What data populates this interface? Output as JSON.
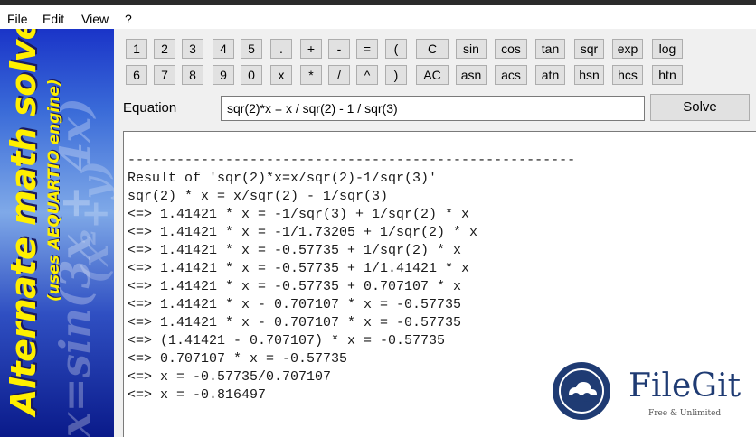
{
  "menu": [
    "File",
    "Edit",
    "View",
    "?"
  ],
  "banner": {
    "title": "Alternate math solver",
    "subtitle": "(uses AEQUARTIO engine)",
    "bg_expr": "x=sin(3x + 4x)",
    "bg_expr2": "(x²+y)"
  },
  "keypad": {
    "row1": [
      "1",
      "2",
      "3",
      "4",
      "5",
      ".",
      "+",
      "-",
      "=",
      "(",
      "C",
      "sin",
      "cos",
      "tan",
      "sqr",
      "exp",
      "log"
    ],
    "row2": [
      "6",
      "7",
      "8",
      "9",
      "0",
      "x",
      "*",
      "/",
      "^",
      ")",
      "AC",
      "asn",
      "acs",
      "atn",
      "hsn",
      "hcs",
      "htn"
    ]
  },
  "equation": {
    "label": "Equation",
    "value": "sqr(2)*x = x / sqr(2) - 1 / sqr(3)",
    "solve_label": "Solve"
  },
  "output_lines": [
    "-------------------------------------------------------",
    "Result of 'sqr(2)*x=x/sqr(2)-1/sqr(3)'",
    "sqr(2) * x = x/sqr(2) - 1/sqr(3)",
    "<=> 1.41421 * x = -1/sqr(3) + 1/sqr(2) * x",
    "<=> 1.41421 * x = -1/1.73205 + 1/sqr(2) * x",
    "<=> 1.41421 * x = -0.57735 + 1/sqr(2) * x",
    "<=> 1.41421 * x = -0.57735 + 1/1.41421 * x",
    "<=> 1.41421 * x = -0.57735 + 0.707107 * x",
    "<=> 1.41421 * x - 0.707107 * x = -0.57735",
    "<=> 1.41421 * x - 0.707107 * x = -0.57735",
    "<=> (1.41421 - 0.707107) * x = -0.57735",
    "<=> 0.707107 * x = -0.57735",
    "<=> x = -0.57735/0.707107",
    "<=> x = -0.816497"
  ],
  "watermark": {
    "name": "FileGit",
    "tagline": "Free & Unlimited"
  }
}
